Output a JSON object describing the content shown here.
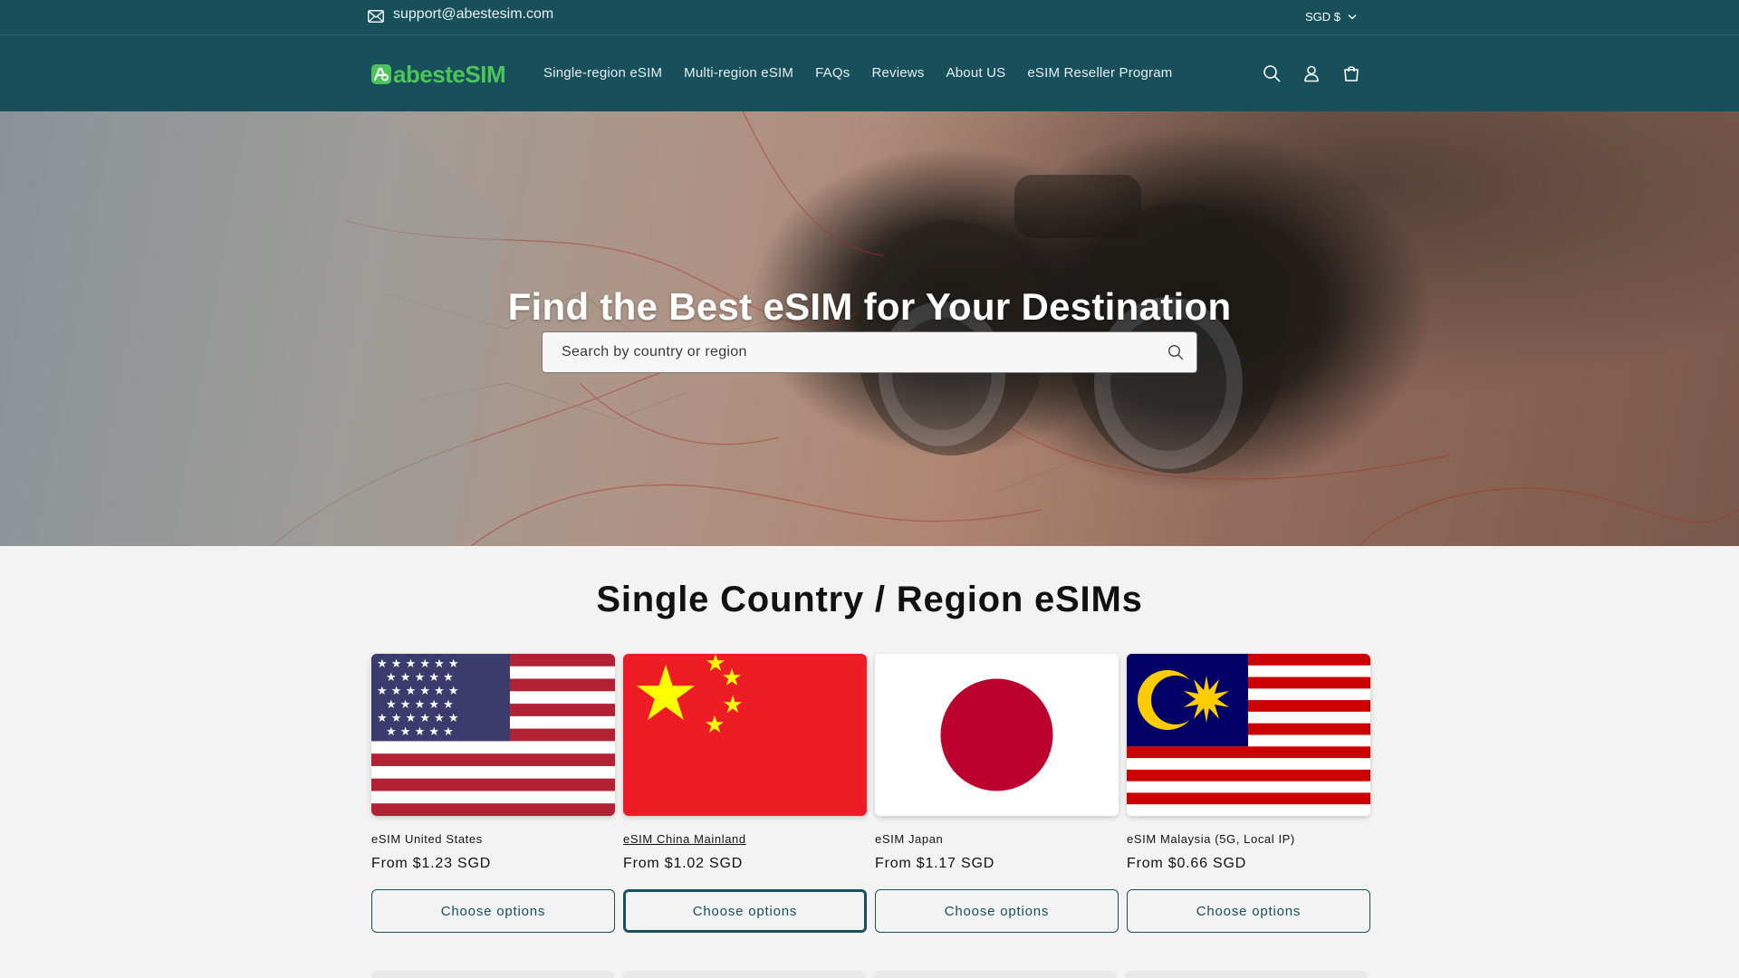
{
  "topbar": {
    "email_icon": "mail-icon",
    "email": "support@abestesim.com",
    "currency": "SGD $",
    "currency_icon": "chevron-down-icon"
  },
  "header": {
    "logo_text": "abesteSIM",
    "nav": [
      {
        "label": "Single-region eSIM"
      },
      {
        "label": "Multi-region eSIM"
      },
      {
        "label": "FAQs"
      },
      {
        "label": "Reviews"
      },
      {
        "label": "About US"
      },
      {
        "label": "eSIM Reseller Program"
      }
    ],
    "icons": [
      "search-icon",
      "account-icon",
      "cart-icon"
    ]
  },
  "hero": {
    "title": "Find the Best eSIM for Your Destination",
    "search_placeholder": "Search by country or region",
    "search_icon": "search-icon"
  },
  "section": {
    "title": "Single Country / Region eSIMs"
  },
  "products": [
    {
      "name": "eSIM United States",
      "price": "From $1.23 SGD",
      "button": "Choose options",
      "flag": "us-flag"
    },
    {
      "name": "eSIM China Mainland",
      "price": "From $1.02 SGD",
      "button": "Choose options",
      "flag": "china-flag"
    },
    {
      "name": "eSIM Japan",
      "price": "From $1.17 SGD",
      "button": "Choose options",
      "flag": "japan-flag"
    },
    {
      "name": "eSIM Malaysia (5G, Local IP)",
      "price": "From $0.66 SGD",
      "button": "Choose options",
      "flag": "malaysia-flag"
    }
  ],
  "colors": {
    "brand_dark": "#17505a",
    "logo_green": "#4cc45a",
    "us_red": "#b22234",
    "us_blue": "#3c3b6e",
    "cn_red": "#ee1c25",
    "cn_yellow": "#ffff00",
    "jp_red": "#bc002d",
    "my_red": "#cc0001",
    "my_blue": "#010066",
    "my_yellow": "#ffcc00"
  }
}
